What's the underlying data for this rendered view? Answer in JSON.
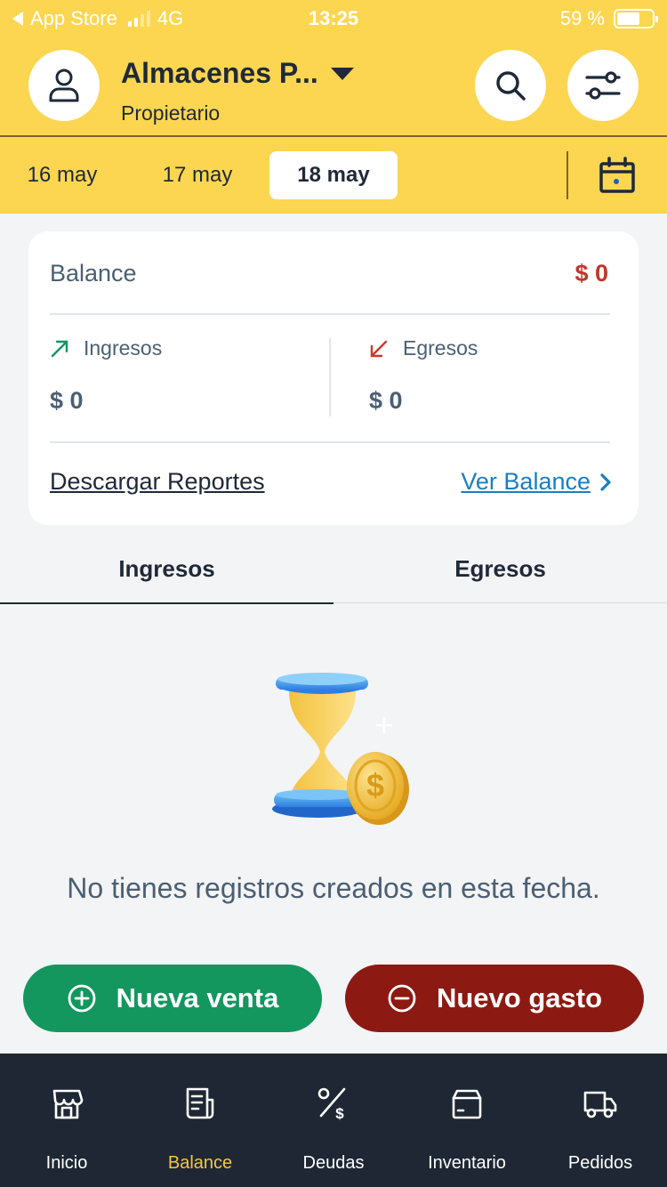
{
  "status_bar": {
    "carrier": "App Store",
    "network": "4G",
    "time": "13:25",
    "battery": "59 %",
    "battery_level": 0.59
  },
  "header": {
    "store_name": "Almacenes P...",
    "role": "Propietario",
    "icons": [
      "user-icon",
      "caret-down-icon",
      "search-icon",
      "filter-sliders-icon"
    ]
  },
  "dates": {
    "items": [
      "16 may",
      "17 may",
      "18 may"
    ],
    "selected": "18 may"
  },
  "balance_card": {
    "balance_label": "Balance",
    "balance_value": "$ 0",
    "income_label": "Ingresos",
    "income_value": "$ 0",
    "expense_label": "Egresos",
    "expense_value": "$ 0",
    "download_link": "Descargar Reportes",
    "view_link": "Ver Balance"
  },
  "tabs": {
    "income": "Ingresos",
    "expenses": "Egresos",
    "active": "Ingresos"
  },
  "empty_state": {
    "message": "No tienes registros creados en esta fecha."
  },
  "actions": {
    "new_sale": "Nueva venta",
    "new_expense": "Nuevo gasto"
  },
  "bottom_nav": {
    "items": [
      {
        "label": "Inicio",
        "icon": "store-icon"
      },
      {
        "label": "Balance",
        "icon": "receipt-icon"
      },
      {
        "label": "Deudas",
        "icon": "percent-dollar-icon"
      },
      {
        "label": "Inventario",
        "icon": "box-icon"
      },
      {
        "label": "Pedidos",
        "icon": "truck-icon"
      }
    ],
    "active": "Balance"
  },
  "colors": {
    "brand_yellow": "#fcd650",
    "income_green": "#13975f",
    "expense_red": "#8d1a12",
    "balance_red": "#c2362b",
    "link_blue": "#1a7fc1",
    "nav_bg": "#1e2733",
    "nav_active": "#f5c842"
  }
}
